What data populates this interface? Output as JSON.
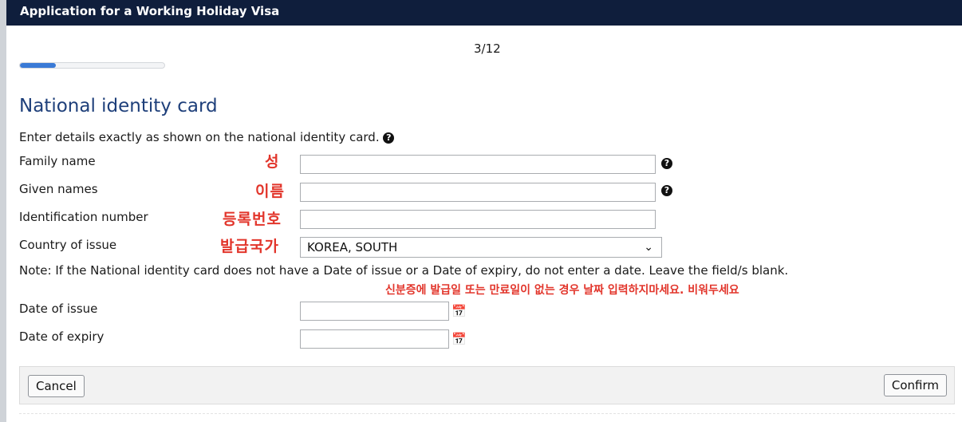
{
  "app": {
    "title": "Application for a Working Holiday Visa"
  },
  "progress": {
    "step_label": "3/12",
    "fraction": 0.25
  },
  "section": {
    "title": "National identity card",
    "intro": "Enter details exactly as shown on the national identity card.",
    "note": "Note: If the National identity card does not have a Date of issue or a Date of expiry, do not enter a date. Leave the field/s blank."
  },
  "fields": {
    "family_name": {
      "label": "Family name",
      "value": "",
      "annotation": "성"
    },
    "given_names": {
      "label": "Given names",
      "value": "",
      "annotation": "이름"
    },
    "identification_number": {
      "label": "Identification number",
      "value": "",
      "annotation": "등록번호"
    },
    "country_of_issue": {
      "label": "Country of issue",
      "value": "KOREA, SOUTH",
      "annotation": "발급국가"
    },
    "date_of_issue": {
      "label": "Date of issue",
      "value": ""
    },
    "date_of_expiry": {
      "label": "Date of expiry",
      "value": ""
    }
  },
  "annotations": {
    "note_korean": "신분증에 발급일 또는 만료일이 없는 경우 날짜 입력하지마세요. 비워두세요"
  },
  "buttons": {
    "cancel": "Cancel",
    "confirm": "Confirm"
  },
  "icons": {
    "help": "question-circle-icon",
    "calendar": "calendar-icon",
    "dropdown": "chevron-down-icon"
  },
  "colors": {
    "topbar": "#0f1e3c",
    "title": "#1e3f7a",
    "progress": "#3a7ad6",
    "annotation": "#e2352b"
  }
}
